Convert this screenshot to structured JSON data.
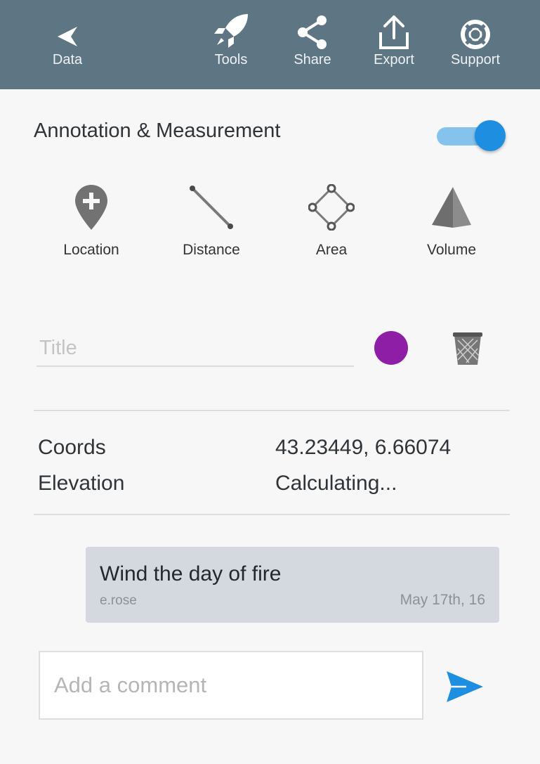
{
  "toolbar": {
    "back_label": "Data",
    "tools_label": "Tools",
    "share_label": "Share",
    "export_label": "Export",
    "support_label": "Support"
  },
  "annotation": {
    "section_title": "Annotation & Measurement",
    "toggle_on": true,
    "accent_color": "#1e8fe0",
    "tools": [
      {
        "label": "Location",
        "icon": "map-pin-add-icon"
      },
      {
        "label": "Distance",
        "icon": "ruler-line-icon"
      },
      {
        "label": "Area",
        "icon": "polygon-area-icon"
      },
      {
        "label": "Volume",
        "icon": "pyramid-volume-icon"
      }
    ]
  },
  "details": {
    "title_placeholder": "Title",
    "title_value": "",
    "color": "#8e1ea6",
    "coords_label": "Coords",
    "coords_value": "43.23449, 6.66074",
    "elevation_label": "Elevation",
    "elevation_value": "Calculating..."
  },
  "comments": [
    {
      "text": "Wind the day of fire",
      "author": "e.rose",
      "date": "May 17th, 16"
    }
  ],
  "comment_input": {
    "placeholder": "Add a comment",
    "value": ""
  }
}
